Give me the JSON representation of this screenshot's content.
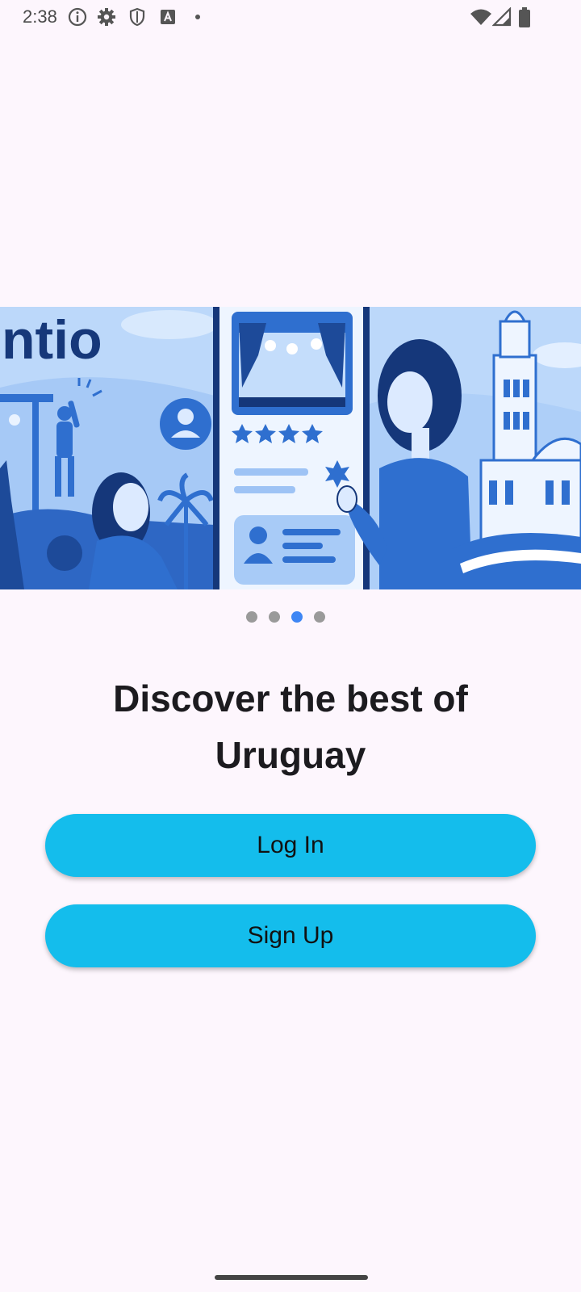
{
  "status_bar": {
    "time": "2:38",
    "icons": [
      "info-icon",
      "gear-icon",
      "shield-icon",
      "text-a-icon",
      "dot-icon",
      "wifi-icon",
      "signal-icon",
      "battery-icon"
    ]
  },
  "hero": {
    "logo_text": "ntio",
    "rating_stars": 4,
    "slides": [
      "event-crowd",
      "rating-card",
      "uruguay-landmark"
    ]
  },
  "carousel": {
    "page_count": 4,
    "active_index": 2,
    "active_color": "#3e86f4",
    "inactive_color": "#9a9a9a"
  },
  "headline": "Discover the best of Uruguay",
  "buttons": {
    "login_label": "Log In",
    "signup_label": "Sign Up",
    "color": "#14bdec"
  },
  "theme": {
    "background": "#fdf6fd",
    "illustration_blue": "#2f6fcf"
  }
}
